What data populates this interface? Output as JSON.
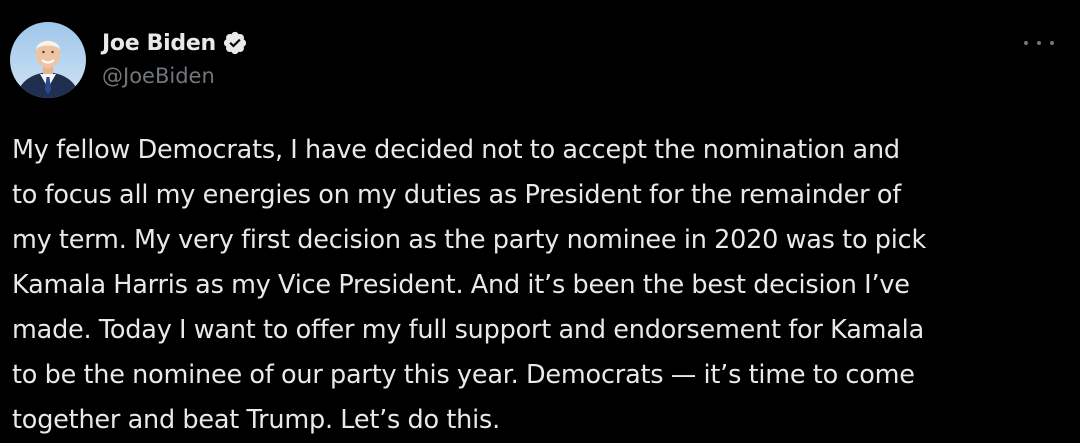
{
  "author": {
    "display_name": "Joe Biden",
    "handle": "@JoeBiden",
    "verified": true,
    "verified_icon": "verified-badge-icon",
    "avatar_icon": "profile-photo"
  },
  "menu": {
    "icon": "more-options-icon"
  },
  "tweet": {
    "lines": [
      "My fellow Democrats, I have decided not to accept the nomination and",
      "to focus all my energies on my duties as President for the remainder of",
      "my term. My very first decision as the party nominee in 2020 was to pick",
      "Kamala Harris as my Vice President. And it’s been the best decision I’ve",
      "made. Today I want to offer my full support and endorsement for Kamala",
      "to be the nominee of our party this year. Democrats — it’s time to come",
      "together and beat Trump. Let’s do this."
    ]
  },
  "colors": {
    "background": "#000000",
    "text_primary": "#e7e9ea",
    "text_secondary": "#71767b",
    "verified_fill": "#e7e9ea"
  }
}
